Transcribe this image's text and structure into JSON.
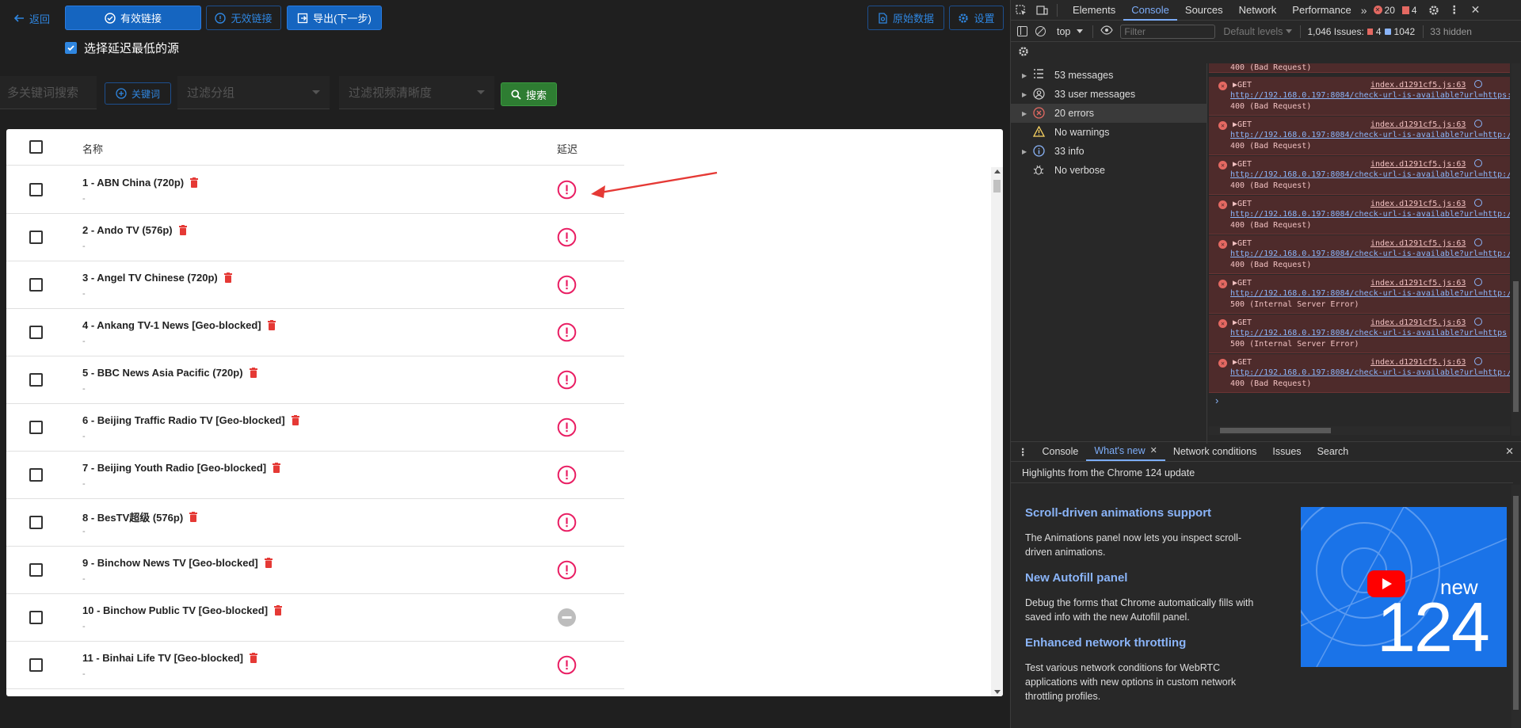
{
  "toolbar": {
    "back_label": "返回",
    "valid_links_label": "有效链接",
    "invalid_links_label": "无效链接",
    "export_label": "导出(下一步)",
    "raw_data_label": "原始数据",
    "settings_label": "设置",
    "select_lowest_label": "选择延迟最低的源",
    "select_lowest_checked": true
  },
  "filters": {
    "keyword_placeholder": "多关键词搜索",
    "keyword_button": "关键词",
    "group_placeholder": "过滤分组",
    "resolution_placeholder": "过滤视频清晰度",
    "search_button": "搜索"
  },
  "table": {
    "col_name": "名称",
    "col_latency": "延迟",
    "rows": [
      {
        "name": "1 - ABN China (720p)",
        "sub": "-",
        "status": "error"
      },
      {
        "name": "2 - Ando TV (576p)",
        "sub": "-",
        "status": "error"
      },
      {
        "name": "3 - Angel TV Chinese (720p)",
        "sub": "-",
        "status": "error"
      },
      {
        "name": "4 - Ankang TV-1 News [Geo-blocked]",
        "sub": "-",
        "status": "error"
      },
      {
        "name": "5 - BBC News Asia Pacific (720p)",
        "sub": "-",
        "status": "error"
      },
      {
        "name": "6 - Beijing Traffic Radio TV [Geo-blocked]",
        "sub": "-",
        "status": "error"
      },
      {
        "name": "7 - Beijing Youth Radio [Geo-blocked]",
        "sub": "-",
        "status": "error"
      },
      {
        "name": "8 - BesTV超级 (576p)",
        "sub": "-",
        "status": "error"
      },
      {
        "name": "9 - Binchow News TV [Geo-blocked]",
        "sub": "-",
        "status": "error"
      },
      {
        "name": "10 - Binchow Public TV [Geo-blocked]",
        "sub": "-",
        "status": "pending"
      },
      {
        "name": "11 - Binhai Life TV [Geo-blocked]",
        "sub": "-",
        "status": "error"
      }
    ]
  },
  "devtools": {
    "tabs": [
      "Elements",
      "Console",
      "Sources",
      "Network",
      "Performance"
    ],
    "active_tab": "Console",
    "error_count": "20",
    "warning_count": "4",
    "context": "top",
    "filter_placeholder": "Filter",
    "levels": "Default levels",
    "issues_label": "1,046 Issues:",
    "issues_err": "4",
    "issues_info": "1042",
    "hidden": "33 hidden",
    "sidebar": [
      {
        "label": "53 messages",
        "icon": "list"
      },
      {
        "label": "33 user messages",
        "icon": "user"
      },
      {
        "label": "20 errors",
        "icon": "error"
      },
      {
        "label": "No warnings",
        "icon": "warning"
      },
      {
        "label": "33 info",
        "icon": "info"
      },
      {
        "label": "No verbose",
        "icon": "bug"
      }
    ],
    "top_partial": "400 (Bad Request)",
    "logs": [
      {
        "method": "▶GET",
        "src": "index.d1291cf5.js:63",
        "url": "http://192.168.0.197:8084/check-url-is-available?url=https:",
        "status": "400 (Bad Request)"
      },
      {
        "method": "▶GET",
        "src": "index.d1291cf5.js:63",
        "url": "http://192.168.0.197:8084/check-url-is-available?url=http:/",
        "status": "400 (Bad Request)"
      },
      {
        "method": "▶GET",
        "src": "index.d1291cf5.js:63",
        "url": "http://192.168.0.197:8084/check-url-is-available?url=http:/",
        "status": "400 (Bad Request)"
      },
      {
        "method": "▶GET",
        "src": "index.d1291cf5.js:63",
        "url": "http://192.168.0.197:8084/check-url-is-available?url=http:/",
        "status": "400 (Bad Request)"
      },
      {
        "method": "▶GET",
        "src": "index.d1291cf5.js:63",
        "url": "http://192.168.0.197:8084/check-url-is-available?url=http:/",
        "status": "400 (Bad Request)"
      },
      {
        "method": "▶GET",
        "src": "index.d1291cf5.js:63",
        "url": "http://192.168.0.197:8084/check-url-is-available?url=http:/",
        "status": "500 (Internal Server Error)"
      },
      {
        "method": "▶GET",
        "src": "index.d1291cf5.js:63",
        "url": "http://192.168.0.197:8084/check-url-is-available?url=https",
        "status": "500 (Internal Server Error)"
      },
      {
        "method": "▶GET",
        "src": "index.d1291cf5.js:63",
        "url": "http://192.168.0.197:8084/check-url-is-available?url=http:/",
        "status": "400 (Bad Request)"
      }
    ],
    "prompt": "›",
    "drawer_tabs": [
      "Console",
      "What's new",
      "Network conditions",
      "Issues",
      "Search"
    ],
    "drawer_active": "What's new",
    "whats_new": {
      "header": "Highlights from the Chrome 124 update",
      "items": [
        {
          "title": "Scroll-driven animations support",
          "body": "The Animations panel now lets you inspect scroll-driven animations."
        },
        {
          "title": "New Autofill panel",
          "body": "Debug the forms that Chrome automatically fills with saved info with the new Autofill panel."
        },
        {
          "title": "Enhanced network throttling",
          "body": "Test various network conditions for WebRTC applications with new options in custom network throttling profiles."
        }
      ],
      "banner_word": "new",
      "banner_number": "124"
    }
  },
  "colors": {
    "primary": "#1565c0",
    "danger": "#e53935",
    "latency_error": "#e91e63",
    "search_green": "#2e7d32",
    "devtools_link": "#8ab4f8",
    "error_bg": "#4e2b2b"
  }
}
